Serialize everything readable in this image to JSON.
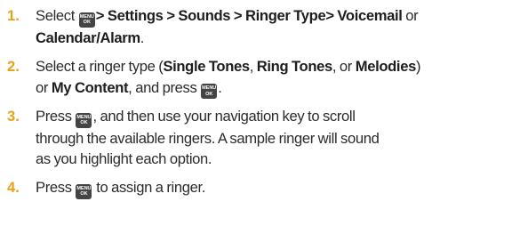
{
  "key_icon": {
    "top": "MENU",
    "bottom": "OK",
    "color": "#444444"
  },
  "accent_color": "#e8a21a",
  "steps": [
    {
      "number": "1.",
      "t_select": "Select",
      "b_path": "> Settings > Sounds > Ringer Type> Voicemail",
      "t_or": "or",
      "b_calendar": "Calendar/Alarm",
      "t_period": "."
    },
    {
      "number": "2.",
      "t_intro": "Select a ringer type (",
      "b_single": "Single Tones",
      "t_comma1": ",",
      "b_ring": "Ring Tones",
      "t_comma_or": ", or",
      "b_melodies": "Melodies",
      "t_paren_or": ")",
      "t_or2": "or",
      "b_mycontent": "My Content",
      "t_press": ", and press",
      "t_end": "."
    },
    {
      "number": "3.",
      "t_press": "Press",
      "t_rest1": ", and then use your navigation key to scroll",
      "t_line2": "through the available ringers. A sample ringer will sound",
      "t_line3": "as you highlight each option."
    },
    {
      "number": "4.",
      "t_press": "Press",
      "t_rest": "to assign a ringer."
    }
  ]
}
